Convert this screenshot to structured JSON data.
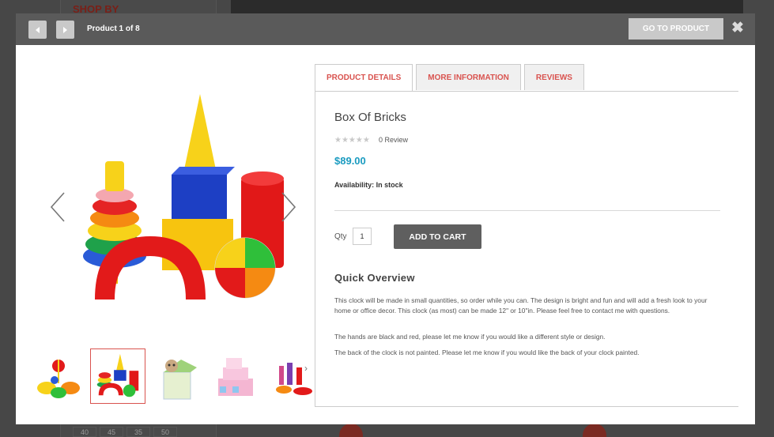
{
  "background": {
    "shop_by": "SHOP BY",
    "sizes": [
      "40",
      "45",
      "35",
      "50"
    ]
  },
  "header": {
    "counter": "Product 1 of 8",
    "goto_label": "GO TO PRODUCT"
  },
  "tabs": [
    {
      "label": "PRODUCT DETAILS",
      "active": true
    },
    {
      "label": "MORE INFORMATION",
      "active": false
    },
    {
      "label": "REVIEWS",
      "active": false
    }
  ],
  "product": {
    "name": "Box Of Bricks",
    "stars": "★★★★★",
    "review": "0 Review",
    "price": "$89.00",
    "availability": "Availability: In stock",
    "qty_label": "Qty",
    "qty_value": "1",
    "add_to_cart": "ADD TO CART"
  },
  "overview": {
    "title": "Quick Overview",
    "paragraphs": [
      "This clock will be made in small quantities, so order while you can. The design is bright and fun and will add a fresh look to your home or office decor. This clock (as most) can be made 12\" or 10\"in. Please feel free to contact me with questions.",
      "The hands are black and red, please let me know if you would like a different style or design.",
      "The back of the clock is not painted. Please let me know if you would like the back of your clock painted."
    ]
  },
  "icons": {
    "prev": "triangle-left-icon",
    "next": "triangle-right-icon",
    "close": "close-icon",
    "gallery_prev": "chevron-left-icon",
    "gallery_next": "chevron-right-icon"
  },
  "colors": {
    "accent_red": "#d9534f",
    "price_blue": "#1a9bc0",
    "button_dark": "#5f5f5f",
    "header_bg": "#5a5a5a"
  }
}
